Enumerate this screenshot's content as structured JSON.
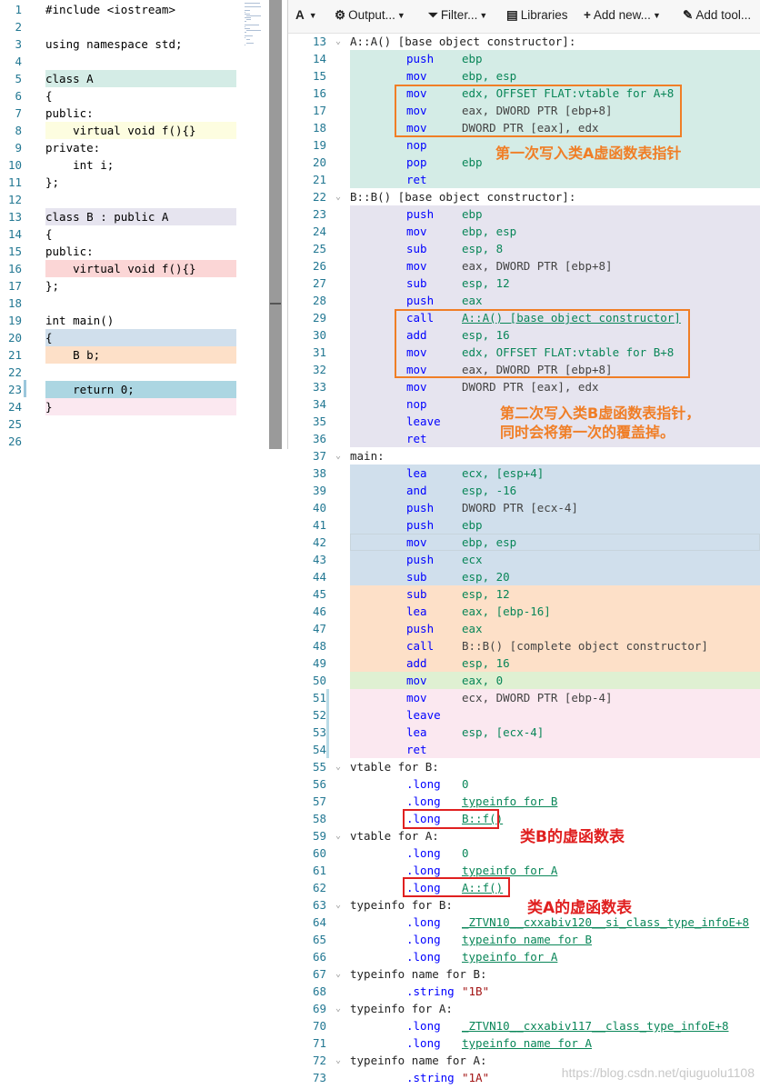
{
  "source": {
    "lines": [
      {
        "n": "1",
        "text": "#include <iostream>",
        "bg": ""
      },
      {
        "n": "2",
        "text": "",
        "bg": ""
      },
      {
        "n": "3",
        "text": "using namespace std;",
        "bg": ""
      },
      {
        "n": "4",
        "text": "",
        "bg": ""
      },
      {
        "n": "5",
        "text": "class A",
        "bg": "#d4ece6"
      },
      {
        "n": "6",
        "text": "{",
        "bg": ""
      },
      {
        "n": "7",
        "text": "public:",
        "bg": ""
      },
      {
        "n": "8",
        "text": "    virtual void f(){}",
        "bg": "#fdfde0"
      },
      {
        "n": "9",
        "text": "private:",
        "bg": ""
      },
      {
        "n": "10",
        "text": "    int i;",
        "bg": ""
      },
      {
        "n": "11",
        "text": "};",
        "bg": ""
      },
      {
        "n": "12",
        "text": "",
        "bg": ""
      },
      {
        "n": "13",
        "text": "class B : public A",
        "bg": "#e6e4ef"
      },
      {
        "n": "14",
        "text": "{",
        "bg": ""
      },
      {
        "n": "15",
        "text": "public:",
        "bg": ""
      },
      {
        "n": "16",
        "text": "    virtual void f(){}",
        "bg": "#fbd6d6"
      },
      {
        "n": "17",
        "text": "};",
        "bg": ""
      },
      {
        "n": "18",
        "text": "",
        "bg": ""
      },
      {
        "n": "19",
        "text": "int main()",
        "bg": ""
      },
      {
        "n": "20",
        "text": "{",
        "bg": "#d0dfec"
      },
      {
        "n": "21",
        "text": "    B b;",
        "bg": "#fde0c8"
      },
      {
        "n": "22",
        "text": "",
        "bg": ""
      },
      {
        "n": "23",
        "text": "    return 0;",
        "bg": "#acd6e2"
      },
      {
        "n": "24",
        "text": "}",
        "bg": "#fbe8f0"
      },
      {
        "n": "25",
        "text": "",
        "bg": ""
      },
      {
        "n": "26",
        "text": "",
        "bg": ""
      }
    ]
  },
  "toolbar": {
    "font_label": "A",
    "output_label": "Output...",
    "filter_label": "Filter...",
    "libraries_label": "Libraries",
    "add_new_label": "Add new...",
    "add_tool_label": "Add tool..."
  },
  "asm": {
    "lines": [
      {
        "n": "13",
        "label": "A::A() [base object constructor]:",
        "op": "",
        "arg": "",
        "bg": ""
      },
      {
        "n": "14",
        "label": "",
        "op": "push",
        "arg": "ebp",
        "bg": "#d4ece6"
      },
      {
        "n": "15",
        "label": "",
        "op": "mov",
        "arg": "ebp, esp",
        "bg": "#d4ece6"
      },
      {
        "n": "16",
        "label": "",
        "op": "mov",
        "arg": "edx, OFFSET FLAT:vtable for A+8",
        "bg": "#d4ece6"
      },
      {
        "n": "17",
        "label": "",
        "op": "mov",
        "arg": "eax, DWORD PTR [ebp+8]",
        "bg": "#d4ece6"
      },
      {
        "n": "18",
        "label": "",
        "op": "mov",
        "arg": "DWORD PTR [eax], edx",
        "bg": "#d4ece6"
      },
      {
        "n": "19",
        "label": "",
        "op": "nop",
        "arg": "",
        "bg": "#d4ece6"
      },
      {
        "n": "20",
        "label": "",
        "op": "pop",
        "arg": "ebp",
        "bg": "#d4ece6"
      },
      {
        "n": "21",
        "label": "",
        "op": "ret",
        "arg": "",
        "bg": "#d4ece6"
      },
      {
        "n": "22",
        "label": "B::B() [base object constructor]:",
        "op": "",
        "arg": "",
        "bg": ""
      },
      {
        "n": "23",
        "label": "",
        "op": "push",
        "arg": "ebp",
        "bg": "#e6e4ef"
      },
      {
        "n": "24",
        "label": "",
        "op": "mov",
        "arg": "ebp, esp",
        "bg": "#e6e4ef"
      },
      {
        "n": "25",
        "label": "",
        "op": "sub",
        "arg": "esp, 8",
        "bg": "#e6e4ef"
      },
      {
        "n": "26",
        "label": "",
        "op": "mov",
        "arg": "eax, DWORD PTR [ebp+8]",
        "bg": "#e6e4ef"
      },
      {
        "n": "27",
        "label": "",
        "op": "sub",
        "arg": "esp, 12",
        "bg": "#e6e4ef"
      },
      {
        "n": "28",
        "label": "",
        "op": "push",
        "arg": "eax",
        "bg": "#e6e4ef"
      },
      {
        "n": "29",
        "label": "",
        "op": "call",
        "arg": "A::A() [base object constructor]",
        "bg": "#e6e4ef"
      },
      {
        "n": "30",
        "label": "",
        "op": "add",
        "arg": "esp, 16",
        "bg": "#e6e4ef"
      },
      {
        "n": "31",
        "label": "",
        "op": "mov",
        "arg": "edx, OFFSET FLAT:vtable for B+8",
        "bg": "#e6e4ef"
      },
      {
        "n": "32",
        "label": "",
        "op": "mov",
        "arg": "eax, DWORD PTR [ebp+8]",
        "bg": "#e6e4ef"
      },
      {
        "n": "33",
        "label": "",
        "op": "mov",
        "arg": "DWORD PTR [eax], edx",
        "bg": "#e6e4ef"
      },
      {
        "n": "34",
        "label": "",
        "op": "nop",
        "arg": "",
        "bg": "#e6e4ef"
      },
      {
        "n": "35",
        "label": "",
        "op": "leave",
        "arg": "",
        "bg": "#e6e4ef"
      },
      {
        "n": "36",
        "label": "",
        "op": "ret",
        "arg": "",
        "bg": "#e6e4ef"
      },
      {
        "n": "37",
        "label": "main:",
        "op": "",
        "arg": "",
        "bg": ""
      },
      {
        "n": "38",
        "label": "",
        "op": "lea",
        "arg": "ecx, [esp+4]",
        "bg": "#d0dfec"
      },
      {
        "n": "39",
        "label": "",
        "op": "and",
        "arg": "esp, -16",
        "bg": "#d0dfec"
      },
      {
        "n": "40",
        "label": "",
        "op": "push",
        "arg": "DWORD PTR [ecx-4]",
        "bg": "#d0dfec"
      },
      {
        "n": "41",
        "label": "",
        "op": "push",
        "arg": "ebp",
        "bg": "#d0dfec"
      },
      {
        "n": "42",
        "label": "",
        "op": "mov",
        "arg": "ebp, esp",
        "bg": "#d0dfec"
      },
      {
        "n": "43",
        "label": "",
        "op": "push",
        "arg": "ecx",
        "bg": "#d0dfec"
      },
      {
        "n": "44",
        "label": "",
        "op": "sub",
        "arg": "esp, 20",
        "bg": "#d0dfec"
      },
      {
        "n": "45",
        "label": "",
        "op": "sub",
        "arg": "esp, 12",
        "bg": "#fde0c8"
      },
      {
        "n": "46",
        "label": "",
        "op": "lea",
        "arg": "eax, [ebp-16]",
        "bg": "#fde0c8"
      },
      {
        "n": "47",
        "label": "",
        "op": "push",
        "arg": "eax",
        "bg": "#fde0c8"
      },
      {
        "n": "48",
        "label": "",
        "op": "call",
        "arg": "B::B() [complete object constructor]",
        "bg": "#fde0c8"
      },
      {
        "n": "49",
        "label": "",
        "op": "add",
        "arg": "esp, 16",
        "bg": "#fde0c8"
      },
      {
        "n": "50",
        "label": "",
        "op": "mov",
        "arg": "eax, 0",
        "bg": "#dff0d2"
      },
      {
        "n": "51",
        "label": "",
        "op": "mov",
        "arg": "ecx, DWORD PTR [ebp-4]",
        "bg": "#fbe8f0"
      },
      {
        "n": "52",
        "label": "",
        "op": "leave",
        "arg": "",
        "bg": "#fbe8f0"
      },
      {
        "n": "53",
        "label": "",
        "op": "lea",
        "arg": "esp, [ecx-4]",
        "bg": "#fbe8f0"
      },
      {
        "n": "54",
        "label": "",
        "op": "ret",
        "arg": "",
        "bg": "#fbe8f0"
      },
      {
        "n": "55",
        "label": "vtable for B:",
        "op": "",
        "arg": "",
        "bg": ""
      },
      {
        "n": "56",
        "label": "",
        "op": ".long",
        "arg": "0",
        "bg": ""
      },
      {
        "n": "57",
        "label": "",
        "op": ".long",
        "arg": "typeinfo for B",
        "bg": ""
      },
      {
        "n": "58",
        "label": "",
        "op": ".long",
        "arg": "B::f()",
        "bg": ""
      },
      {
        "n": "59",
        "label": "vtable for A:",
        "op": "",
        "arg": "",
        "bg": ""
      },
      {
        "n": "60",
        "label": "",
        "op": ".long",
        "arg": "0",
        "bg": ""
      },
      {
        "n": "61",
        "label": "",
        "op": ".long",
        "arg": "typeinfo for A",
        "bg": ""
      },
      {
        "n": "62",
        "label": "",
        "op": ".long",
        "arg": "A::f()",
        "bg": ""
      },
      {
        "n": "63",
        "label": "typeinfo for B:",
        "op": "",
        "arg": "",
        "bg": ""
      },
      {
        "n": "64",
        "label": "",
        "op": ".long",
        "arg": "_ZTVN10__cxxabiv120__si_class_type_infoE+8",
        "bg": ""
      },
      {
        "n": "65",
        "label": "",
        "op": ".long",
        "arg": "typeinfo name for B",
        "bg": ""
      },
      {
        "n": "66",
        "label": "",
        "op": ".long",
        "arg": "typeinfo for A",
        "bg": ""
      },
      {
        "n": "67",
        "label": "typeinfo name for B:",
        "op": "",
        "arg": "",
        "bg": ""
      },
      {
        "n": "68",
        "label": "",
        "op": ".string",
        "arg": "\"1B\"",
        "bg": ""
      },
      {
        "n": "69",
        "label": "typeinfo for A:",
        "op": "",
        "arg": "",
        "bg": ""
      },
      {
        "n": "70",
        "label": "",
        "op": ".long",
        "arg": "_ZTVN10__cxxabiv117__class_type_infoE+8",
        "bg": ""
      },
      {
        "n": "71",
        "label": "",
        "op": ".long",
        "arg": "typeinfo name for A",
        "bg": ""
      },
      {
        "n": "72",
        "label": "typeinfo name for A:",
        "op": "",
        "arg": "",
        "bg": ""
      },
      {
        "n": "73",
        "label": "",
        "op": ".string",
        "arg": "\"1A\"",
        "bg": ""
      }
    ]
  },
  "annotations": {
    "note1": "第一次写入类A虚函数表指针",
    "note2_line1": "第二次写入类B虚函数表指针，",
    "note2_line2": "同时会将第一次的覆盖掉。",
    "note3": "类B的虚函数表",
    "note4": "类A的虚函数表",
    "orange": "#f07e26",
    "red": "#e02020"
  },
  "watermark": "https://blog.csdn.net/qiuguolu1108"
}
